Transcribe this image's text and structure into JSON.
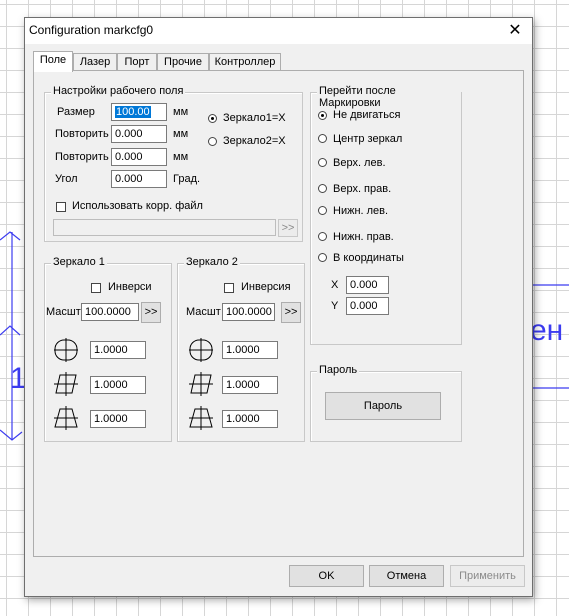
{
  "window": {
    "title": "Configuration markcfg0",
    "close_glyph": "✕"
  },
  "tabs": [
    {
      "label": "Поле",
      "active": true
    },
    {
      "label": "Лазер"
    },
    {
      "label": "Порт"
    },
    {
      "label": "Прочие"
    },
    {
      "label": "Контроллер"
    }
  ],
  "field_settings": {
    "title": "Настройки рабочего поля",
    "size_label": "Размер",
    "size_value": "100.00",
    "size_unit": "мм",
    "repeat1_label": "Повторить",
    "repeat1_value": "0.000",
    "repeat1_unit": "мм",
    "repeat2_label": "Повторить",
    "repeat2_value": "0.000",
    "repeat2_unit": "мм",
    "angle_label": "Угол",
    "angle_value": "0.000",
    "angle_unit": "Град.",
    "mirror1_label": "Зеркало1=X",
    "mirror2_label": "Зеркало2=X",
    "corr_file_label": "Использовать корр. файл",
    "corr_file_path": "",
    "browse_label": ">>"
  },
  "mirror1": {
    "title": "Зеркало 1",
    "invert_label": "Инверси",
    "scale_label": "Масшт",
    "scale_value": "100.0000",
    "scale_btn": ">>",
    "val1": "1.0000",
    "val2": "1.0000",
    "val3": "1.0000"
  },
  "mirror2": {
    "title": "Зеркало 2",
    "invert_label": "Инверсия",
    "scale_label": "Масшт",
    "scale_value": "100.0000",
    "scale_btn": ">>",
    "val1": "1.0000",
    "val2": "1.0000",
    "val3": "1.0000"
  },
  "after_marking": {
    "title": "Перейти после Маркировки",
    "options": [
      "Не двигаться",
      "Центр зеркал",
      "Верх. лев.",
      "Верх. прав.",
      "Нижн. лев.",
      "Нижн. прав.",
      "В координаты"
    ],
    "selected": "Не двигаться",
    "x_label": "X",
    "x_value": "0.000",
    "y_label": "Y",
    "y_value": "0.000"
  },
  "password": {
    "title": "Пароль",
    "button_label": "Пароль"
  },
  "footer": {
    "ok_label": "OK",
    "cancel_label": "Отмена",
    "apply_label": "Применить"
  },
  "background": {
    "partial_text_right": "ен",
    "partial_text_left": "1"
  },
  "colors": {
    "selection": "#0078d7",
    "bg_drawing": "#3c3cf0"
  }
}
